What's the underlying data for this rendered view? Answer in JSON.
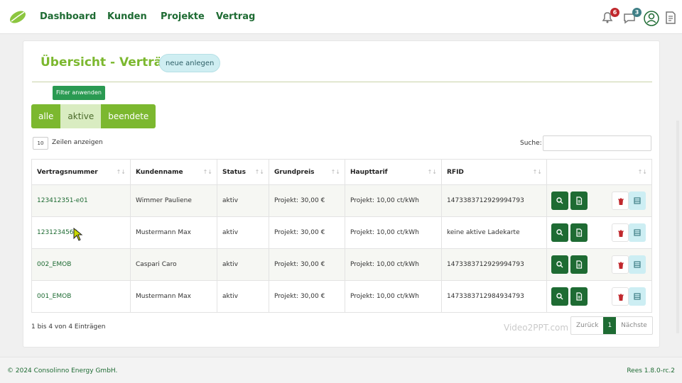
{
  "nav": {
    "items": [
      "Dashboard",
      "Kunden",
      "Projekte",
      "Vertrag"
    ],
    "notifications": {
      "alerts_count": "6",
      "messages_count": "3"
    }
  },
  "page": {
    "title": "Übersicht - Verträge",
    "new_label": "neue anlegen",
    "filter_label": "Filter anwenden",
    "segments": [
      "alle",
      "aktive",
      "beendete"
    ],
    "page_length": "10",
    "page_length_label": "Zeilen anzeigen",
    "search_label": "Suche:",
    "search_value": ""
  },
  "table": {
    "headers": [
      "Vertragsnummer",
      "Kundenname",
      "Status",
      "Grundpreis",
      "Haupttarif",
      "RFID",
      ""
    ],
    "rows": [
      {
        "nr": "123412351-e01",
        "name": "Wimmer Pauliene",
        "status": "aktiv",
        "grundpreis": "Projekt: 30,00 €",
        "tarif": "Projekt: 10,00 ct/kWh",
        "rfid": "1473383712929994793"
      },
      {
        "nr": "1231234569",
        "name": "Mustermann Max",
        "status": "aktiv",
        "grundpreis": "Projekt: 30,00 €",
        "tarif": "Projekt: 10,00 ct/kWh",
        "rfid": "keine aktive Ladekarte"
      },
      {
        "nr": "002_EMOB",
        "name": "Caspari Caro",
        "status": "aktiv",
        "grundpreis": "Projekt: 30,00 €",
        "tarif": "Projekt: 10,00 ct/kWh",
        "rfid": "1473383712929994793"
      },
      {
        "nr": "001_EMOB",
        "name": "Mustermann Max",
        "status": "aktiv",
        "grundpreis": "Projekt: 30,00 €",
        "tarif": "Projekt: 10,00 ct/kWh",
        "rfid": "1473383712984934793"
      }
    ],
    "sort_glyph": "↑↓"
  },
  "pagination": {
    "info": "1 bis 4 von 4 Einträgen",
    "prev": "Zurück",
    "current": "1",
    "next": "Nächste"
  },
  "watermark": "Video2PPT.com",
  "footer": {
    "copyright": "© 2024 Consolinno Energy GmbH.",
    "version": "Rees 1.8.0-rc.2"
  },
  "colors": {
    "brand_green": "#1e6b33",
    "accent_lime": "#7cb82f",
    "badge_red": "#c0282d",
    "badge_teal": "#3f7f86"
  },
  "icons": [
    "logo-leaf-icon",
    "bell-icon",
    "chat-icon",
    "user-icon",
    "document-icon",
    "search-icon",
    "file-icon",
    "trash-icon",
    "list-icon"
  ]
}
